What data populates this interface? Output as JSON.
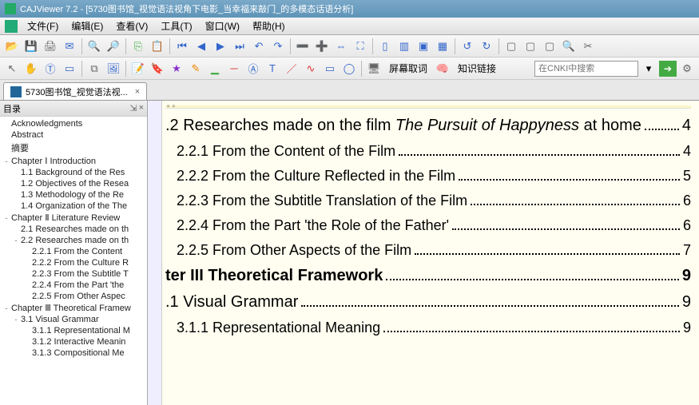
{
  "window": {
    "title": "CAJViewer 7.2 - [5730图书馆_视觉语法视角下电影_当幸福来敲门_的多模态话语分析]"
  },
  "menu": {
    "file": "文件(F)",
    "edit": "编辑(E)",
    "view": "查看(V)",
    "tools": "工具(T)",
    "window": "窗口(W)",
    "help": "帮助(H)"
  },
  "toolbar2": {
    "screen": "屏幕取词",
    "knowlink": "知识链接",
    "search_placeholder": "在CNKI中搜索"
  },
  "tab": {
    "label": "5730图书馆_视觉语法视..."
  },
  "sidebar": {
    "title": "目录",
    "items": [
      {
        "label": "Acknowledgments",
        "lvl": 0,
        "exp": ""
      },
      {
        "label": "Abstract",
        "lvl": 0,
        "exp": ""
      },
      {
        "label": "摘要",
        "lvl": 0,
        "exp": ""
      },
      {
        "label": "Chapter Ⅰ Introduction",
        "lvl": 0,
        "exp": "-"
      },
      {
        "label": "1.1 Background of the Res",
        "lvl": 1,
        "exp": ""
      },
      {
        "label": "1.2 Objectives of the Resea",
        "lvl": 1,
        "exp": ""
      },
      {
        "label": "1.3 Methodology of the Re",
        "lvl": 1,
        "exp": ""
      },
      {
        "label": "1.4 Organization of the The",
        "lvl": 1,
        "exp": ""
      },
      {
        "label": "Chapter Ⅱ Literature Review",
        "lvl": 0,
        "exp": "-"
      },
      {
        "label": "2.1 Researches made on th",
        "lvl": 1,
        "exp": ""
      },
      {
        "label": "2.2 Researches made on th",
        "lvl": 1,
        "exp": "-"
      },
      {
        "label": "2.2.1 From the Content",
        "lvl": 2,
        "exp": ""
      },
      {
        "label": "2.2.2 From the Culture R",
        "lvl": 2,
        "exp": ""
      },
      {
        "label": "2.2.3 From the Subtitle T",
        "lvl": 2,
        "exp": ""
      },
      {
        "label": "2.2.4 From the Part 'the",
        "lvl": 2,
        "exp": ""
      },
      {
        "label": "2.2.5 From Other Aspec",
        "lvl": 2,
        "exp": ""
      },
      {
        "label": "Chapter Ⅲ Theoretical Framew",
        "lvl": 0,
        "exp": "-"
      },
      {
        "label": "3.1 Visual Grammar",
        "lvl": 1,
        "exp": "-"
      },
      {
        "label": "3.1.1 Representational M",
        "lvl": 2,
        "exp": ""
      },
      {
        "label": "3.1.2 Interactive Meanin",
        "lvl": 2,
        "exp": ""
      },
      {
        "label": "3.1.3 Compositional Me",
        "lvl": 2,
        "exp": ""
      }
    ]
  },
  "content": {
    "l0_pre": ".2 Researches made on the film ",
    "l0_it": "The Pursuit of Happyness",
    "l0_post": " at home",
    "l0_pg": "4",
    "l1": "2.2.1 From the Content of the Film ",
    "l1_pg": "4",
    "l2": "2.2.2 From the Culture Reflected in the Film",
    "l2_pg": "5",
    "l3": "2.2.3 From the Subtitle Translation of the Film ",
    "l3_pg": "6",
    "l4": "2.2.4 From the Part 'the Role of the Father'",
    "l4_pg": "6",
    "l5": "2.2.5 From Other Aspects of the Film ",
    "l5_pg": "7",
    "l6": "ter III Theoretical Framework",
    "l6_pg": "9",
    "l7": ".1 Visual Grammar",
    "l7_pg": "9",
    "l8": "3.1.1 Representational Meaning ",
    "l8_pg": "9"
  }
}
